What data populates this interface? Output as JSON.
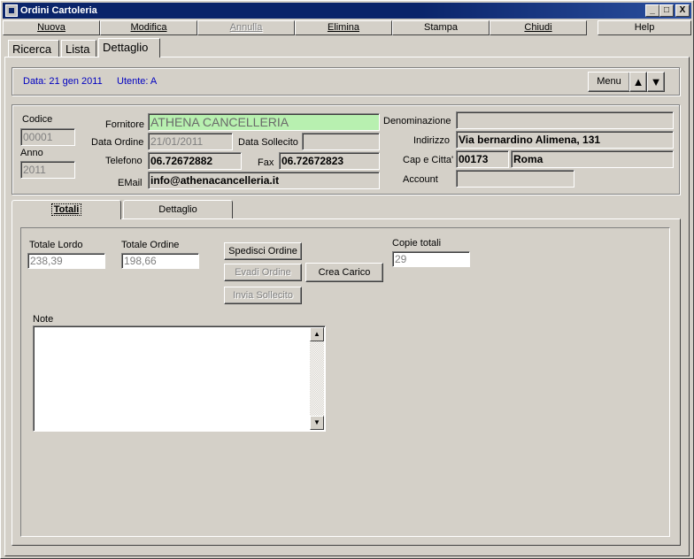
{
  "window": {
    "title": "Ordini Cartoleria"
  },
  "titlebar_buttons": {
    "minimize": "_",
    "maximize": "□",
    "close": "X"
  },
  "menu": {
    "nuova": "Nuova",
    "modifica": "Modifica",
    "annulla": "Annulla",
    "elimina": "Elimina",
    "stampa": "Stampa",
    "chiudi": "Chiudi",
    "help": "Help"
  },
  "top_tabs": {
    "ricerca": "Ricerca",
    "lista": "Lista",
    "dettaglio": "Dettaglio"
  },
  "infobar": {
    "date": "Data: 21 gen 2011",
    "user": "Utente: A",
    "menu_button": "Menu",
    "up_icon": "▲",
    "down_icon": "▼"
  },
  "header": {
    "codice_label": "Codice",
    "codice": "00001",
    "anno_label": "Anno",
    "anno": "2011",
    "fornitore_label": "Fornitore",
    "fornitore": "ATHENA CANCELLERIA",
    "data_ordine_label": "Data Ordine",
    "data_ordine": "21/01/2011",
    "data_sollecito_label": "Data Sollecito",
    "data_sollecito": "",
    "telefono_label": "Telefono",
    "telefono": "06.72672882",
    "fax_label": "Fax",
    "fax": "06.72672823",
    "email_label": "EMail",
    "email": "info@athenacancelleria.it",
    "denominazione_label": "Denominazione",
    "denominazione": "",
    "indirizzo_label": "Indirizzo",
    "indirizzo": "Via bernardino Alimena, 131",
    "cap_citta_label": "Cap e Citta'",
    "cap": "00173",
    "citta": "Roma",
    "account_label": "Account",
    "account": ""
  },
  "detail_tabs": {
    "totali": "Totali",
    "dettaglio": "Dettaglio"
  },
  "totali": {
    "totale_lordo_label": "Totale Lordo",
    "totale_lordo": "238,39",
    "totale_ordine_label": "Totale Ordine",
    "totale_ordine": "198,66",
    "spedisci": "Spedisci Ordine",
    "evadi": "Evadi Ordine",
    "invia_sollecito": "Invia Sollecito",
    "crea_carico": "Crea Carico",
    "copie_totali_label": "Copie totali",
    "copie_totali": "29",
    "note_label": "Note",
    "note": "",
    "scroll_up_icon": "▲",
    "scroll_down_icon": "▼"
  }
}
